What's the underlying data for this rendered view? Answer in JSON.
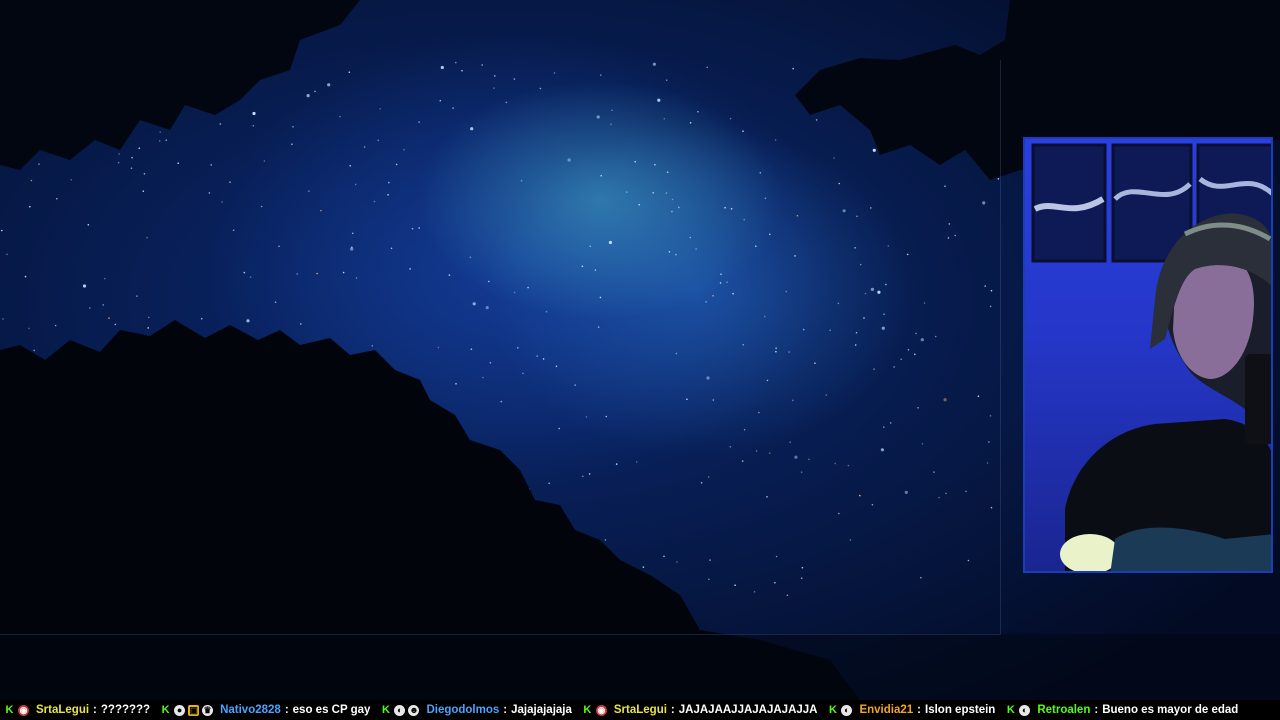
{
  "colors": {
    "kick_green": "#53fc18",
    "chat_text": "#ffffff",
    "webcam_border": "#1b3db8"
  },
  "chat": {
    "separator": ":",
    "messages": [
      {
        "username": "SrtaLegui",
        "color": "#e5e54c",
        "badges": [
          "kick-icon",
          "red-circle-badge-icon"
        ],
        "text": "???????"
      },
      {
        "username": "Nativo2828",
        "color": "#4aa3ff",
        "badges": [
          "kick-icon",
          "balloon-badge-icon",
          "gift-badge-icon",
          "crown-badge-icon"
        ],
        "text": "eso es CP gay"
      },
      {
        "username": "Diegodolmos",
        "color": "#4aa3ff",
        "badges": [
          "kick-icon",
          "moon-badge-icon",
          "bot-badge-icon"
        ],
        "text": "Jajajajajaja"
      },
      {
        "username": "SrtaLegui",
        "color": "#e5e54c",
        "badges": [
          "kick-icon",
          "red-circle-badge-icon"
        ],
        "text": "JAJAJAAJJAJAJAJAJJA"
      },
      {
        "username": "Envidia21",
        "color": "#f2a32a",
        "badges": [
          "kick-icon",
          "moon-badge-icon"
        ],
        "text": "Islon epstein"
      },
      {
        "username": "Retroalen",
        "color": "#53fc18",
        "badges": [
          "kick-icon",
          "moon-badge-icon"
        ],
        "text": "Bueno es mayor de edad"
      }
    ]
  }
}
